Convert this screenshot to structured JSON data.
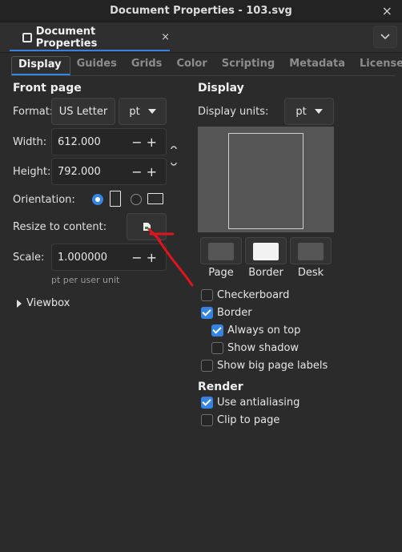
{
  "window": {
    "title": "Document Properties - 103.svg",
    "close": "×"
  },
  "dock": {
    "tab_label": "Document Properties",
    "tab_close": "×",
    "menu_icon": "chevron-down-icon"
  },
  "tabs": [
    "Display",
    "Guides",
    "Grids",
    "Color",
    "Scripting",
    "Metadata",
    "License"
  ],
  "active_tab": "Display",
  "front_page": {
    "title": "Front page",
    "format_label": "Format:",
    "format_value": "US Letter",
    "unit_value": "pt",
    "width_label": "Width:",
    "width_value": "612.000",
    "height_label": "Height:",
    "height_value": "792.000",
    "orientation_label": "Orientation:",
    "orientation_selected": "portrait",
    "resize_label": "Resize to content:",
    "scale_label": "Scale:",
    "scale_value": "1.000000",
    "scale_hint": "pt per user unit",
    "viewbox_label": "Viewbox"
  },
  "display": {
    "title": "Display",
    "units_label": "Display units:",
    "units_value": "pt",
    "swatches": [
      {
        "label": "Page",
        "color": "#555555"
      },
      {
        "label": "Border",
        "color": "#f2f2f2"
      },
      {
        "label": "Desk",
        "color": "#555555"
      }
    ],
    "checkboxes": [
      {
        "label": "Checkerboard",
        "checked": false
      },
      {
        "label": "Border",
        "checked": true
      },
      {
        "label": "Always on top",
        "checked": true
      },
      {
        "label": "Show shadow",
        "checked": false
      },
      {
        "label": "Show big page labels",
        "checked": false
      }
    ]
  },
  "render": {
    "title": "Render",
    "checkboxes": [
      {
        "label": "Use antialiasing",
        "checked": true
      },
      {
        "label": "Clip to page",
        "checked": false
      }
    ]
  },
  "colors": {
    "accent": "#3584e4",
    "annotation_arrow": "#e0141e",
    "background": "#2b2b2b"
  }
}
